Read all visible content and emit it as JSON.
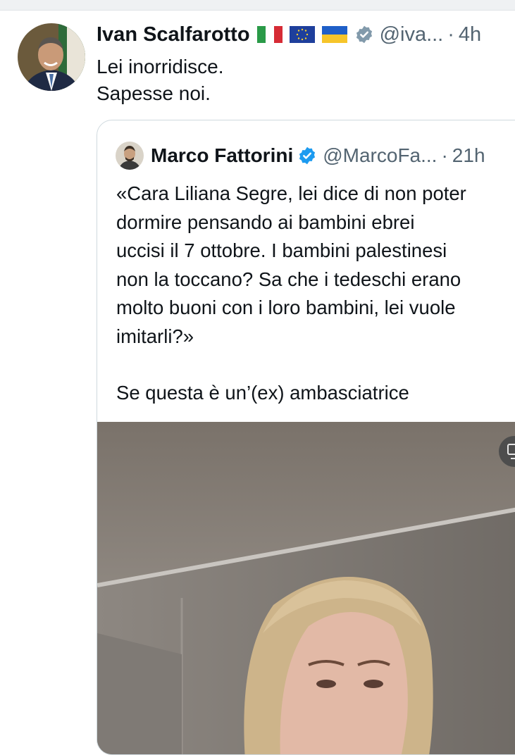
{
  "tweet": {
    "author_name": "Ivan Scalfarotto",
    "handle": "@iva...",
    "separator": "·",
    "time": "4h",
    "text_lines": [
      "Lei inorridisce.",
      "Sapesse noi."
    ],
    "flags": [
      "italy-flag-icon",
      "eu-flag-icon",
      "ukraine-flag-icon"
    ],
    "verified_badge": "grey-verified-icon"
  },
  "quote": {
    "author_name": "Marco Fattorini",
    "handle": "@MarcoFa...",
    "separator": "·",
    "time": "21h",
    "verified_badge": "blue-verified-icon",
    "text_lines": [
      "«Cara Liliana Segre, lei dice di non poter",
      "dormire pensando ai bambini ebrei",
      "uccisi il 7 ottobre. I bambini palestinesi",
      "non la toccano? Sa che i tedeschi erano",
      "molto buoni con i loro bambini, lei vuole",
      "imitarli?»"
    ],
    "text_after": "Se questa è un’(ex) ambasciatrice",
    "media_icon": "media-options-icon"
  },
  "colors": {
    "text_primary": "#0f1419",
    "text_secondary": "#536471",
    "verified_blue": "#1d9bf0",
    "border": "#cfd9de"
  }
}
